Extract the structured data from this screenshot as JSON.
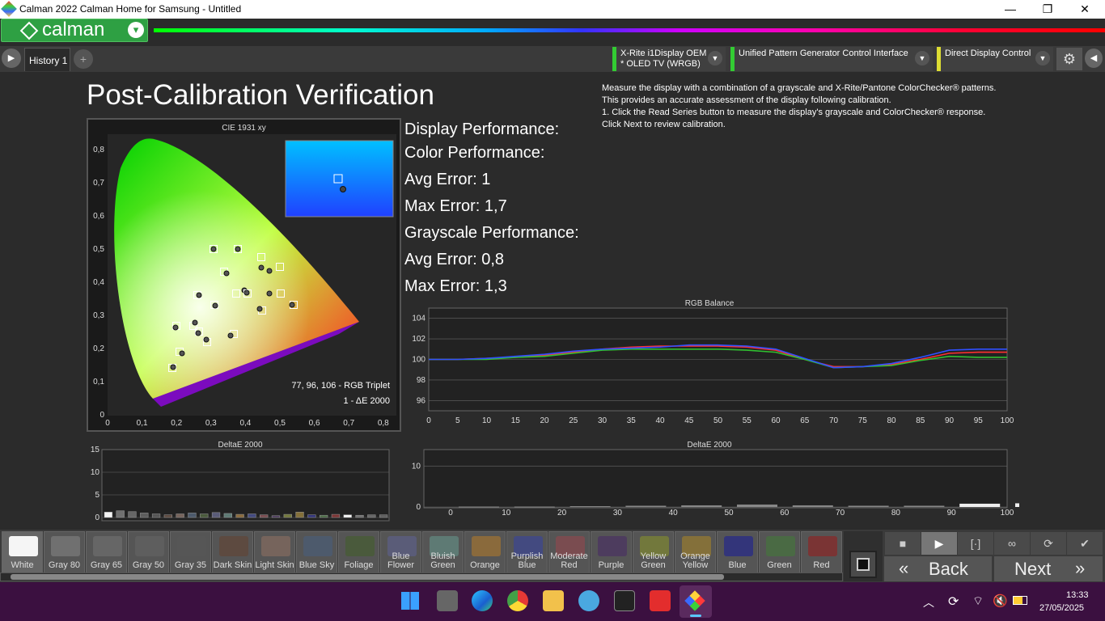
{
  "window": {
    "title": "Calman 2022 Calman Home for Samsung  - Untitled",
    "min": "—",
    "max": "❐",
    "close": "✕"
  },
  "app": {
    "logo": "calman",
    "logo_dropdown": "▾"
  },
  "tabs": {
    "history_tab": "History 1",
    "add_tab": "+"
  },
  "devices": [
    {
      "line1": "X-Rite i1Display OEM",
      "line2": "* OLED TV (WRGB)",
      "color": "#33cc33"
    },
    {
      "line1": "Unified Pattern Generator Control Interface",
      "line2": "",
      "color": "#33cc33"
    },
    {
      "line1": "Direct Display Control",
      "line2": "",
      "color": "#dddd33"
    }
  ],
  "page": {
    "title": "Post-Calibration Verification",
    "instructions": [
      "Measure the display with a combination of a grayscale and X-Rite/Pantone ColorChecker® patterns.",
      "This provides an accurate assessment of the display following calibration.",
      "1. Click the Read Series button to measure the display's grayscale and ColorChecker® response.",
      "Click Next to review calibration."
    ]
  },
  "performance": {
    "display": "Display Performance:",
    "color": "Color Performance:",
    "color_avg": "Avg Error: 1",
    "color_max": "Max Error: 1,7",
    "grayscale": "Grayscale Performance:",
    "gray_avg": "Avg Error: 0,8",
    "gray_max": "Max Error: 1,3"
  },
  "cie": {
    "title": "CIE 1931 xy",
    "triplet": "77, 96, 106 - RGB Triplet",
    "de": "1 - ΔE 2000",
    "x_ticks": [
      "0",
      "0,1",
      "0,2",
      "0,3",
      "0,4",
      "0,5",
      "0,6",
      "0,7",
      "0,8"
    ],
    "y_ticks": [
      "0,8",
      "0,7",
      "0,6",
      "0,5",
      "0,4",
      "0,3",
      "0,2",
      "0,1",
      "0"
    ]
  },
  "chart_data": [
    {
      "type": "line",
      "title": "RGB Balance",
      "x": [
        0,
        5,
        10,
        15,
        20,
        25,
        30,
        35,
        40,
        45,
        50,
        55,
        60,
        65,
        70,
        75,
        80,
        85,
        90,
        95,
        100
      ],
      "x_ticks": [
        "0",
        "5",
        "10",
        "15",
        "20",
        "25",
        "30",
        "35",
        "40",
        "45",
        "50",
        "55",
        "60",
        "65",
        "70",
        "75",
        "80",
        "85",
        "90",
        "95",
        "100"
      ],
      "y_ticks": [
        "104",
        "102",
        "100",
        "98",
        "96"
      ],
      "ylim": [
        95,
        105
      ],
      "series": [
        {
          "color": "#ff3030",
          "values": [
            100,
            100,
            100.1,
            100.2,
            100.4,
            100.7,
            101.0,
            101.2,
            101.3,
            101.3,
            101.3,
            101.2,
            100.9,
            100.0,
            99.3,
            99.3,
            99.5,
            100.0,
            100.6,
            100.7,
            100.7
          ]
        },
        {
          "color": "#30c030",
          "values": [
            100,
            100,
            100.0,
            100.2,
            100.3,
            100.6,
            100.9,
            101.0,
            101.0,
            101.0,
            101.0,
            100.9,
            100.7,
            100.0,
            99.2,
            99.3,
            99.4,
            99.9,
            100.3,
            100.2,
            100.2
          ]
        },
        {
          "color": "#3050ff",
          "values": [
            100,
            100,
            100.1,
            100.3,
            100.5,
            100.8,
            101.0,
            101.1,
            101.2,
            101.4,
            101.4,
            101.3,
            101.0,
            100.1,
            99.2,
            99.3,
            99.6,
            100.2,
            100.9,
            101.0,
            101.0
          ]
        }
      ]
    },
    {
      "type": "bar",
      "title": "DeltaE 2000",
      "y_ticks": [
        "15",
        "10",
        "5",
        "0"
      ],
      "ylim": [
        0,
        15
      ],
      "values": [
        1.2,
        1.5,
        1.3,
        1.0,
        0.8,
        0.6,
        0.8,
        1.0,
        0.8,
        1.1,
        0.9,
        0.7,
        0.8,
        0.6,
        0.4,
        0.7,
        1.2,
        0.6,
        0.5,
        0.7,
        0.6,
        0.5,
        0.6,
        0.6
      ]
    },
    {
      "type": "bar",
      "title": "DeltaE 2000",
      "x_ticks": [
        "0",
        "10",
        "20",
        "30",
        "40",
        "50",
        "60",
        "70",
        "80",
        "90",
        "100"
      ],
      "y_ticks": [
        "10",
        "0"
      ],
      "ylim": [
        0,
        14
      ],
      "values": [
        0.1,
        0.1,
        0.2,
        0.3,
        0.4,
        0.6,
        0.4,
        0.3,
        0.3,
        0.8,
        0.9
      ]
    }
  ],
  "swatches": [
    {
      "label": "White",
      "color": "#f5f5f5"
    },
    {
      "label": "Gray 80",
      "color": "#707070"
    },
    {
      "label": "Gray 65",
      "color": "#666666"
    },
    {
      "label": "Gray 50",
      "color": "#5e5e5e"
    },
    {
      "label": "Gray 35",
      "color": "#565656"
    },
    {
      "label": "Dark Skin",
      "color": "#5d4a40"
    },
    {
      "label": "Light Skin",
      "color": "#76645c"
    },
    {
      "label": "Blue Sky",
      "color": "#4d5a6c"
    },
    {
      "label": "Foliage",
      "color": "#4a5a3c"
    },
    {
      "label": "Blue Flower",
      "color": "#5a5c78"
    },
    {
      "label": "Bluish Green",
      "color": "#5e7a74"
    },
    {
      "label": "Orange",
      "color": "#8a6a3c"
    },
    {
      "label": "Purplish Blue",
      "color": "#434a80"
    },
    {
      "label": "Moderate Red",
      "color": "#7a4c50"
    },
    {
      "label": "Purple",
      "color": "#4d3c5e"
    },
    {
      "label": "Yellow Green",
      "color": "#72783c"
    },
    {
      "label": "Orange Yellow",
      "color": "#84703a"
    },
    {
      "label": "Blue",
      "color": "#33357a"
    },
    {
      "label": "Green",
      "color": "#4a6a44"
    },
    {
      "label": "Red",
      "color": "#7a3434"
    }
  ],
  "nav": {
    "back": "Back",
    "next": "Next",
    "back_icon": "«",
    "next_icon": "»"
  },
  "clock": {
    "time": "13:33",
    "date": "27/05/2025"
  }
}
